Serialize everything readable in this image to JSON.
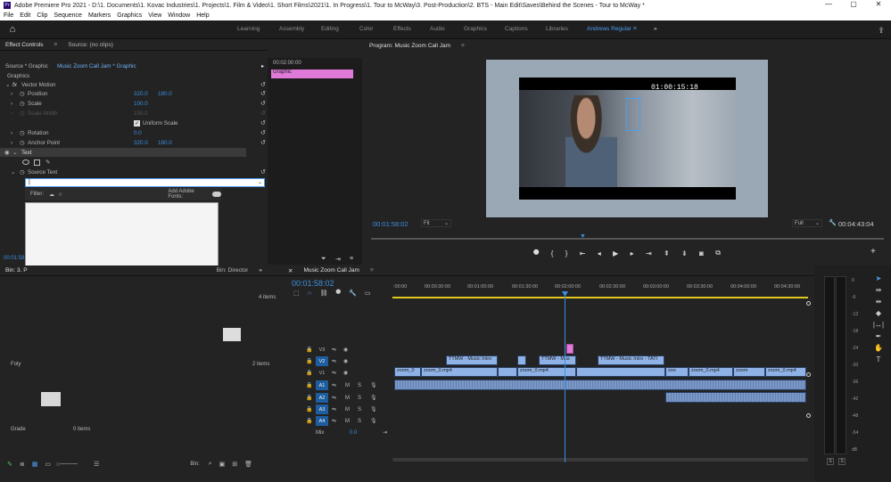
{
  "title_bar": {
    "app_icon": "Pr",
    "title": "Adobe Premiere Pro 2021 - D:\\1. Documents\\1. Kovac Industries\\1. Projects\\1. Film & Video\\1. Short Films\\2021\\1. In Progress\\1. Tour to McWay\\3. Post-Production\\2. BTS - Main Edit\\Saves\\Behind the Scenes - Tour to McWay *",
    "minimize": "—",
    "maximize": "▢",
    "close": "✕"
  },
  "menu": [
    "File",
    "Edit",
    "Clip",
    "Sequence",
    "Markers",
    "Graphics",
    "View",
    "Window",
    "Help"
  ],
  "workspaces": {
    "tabs": [
      "Learning",
      "Assembly",
      "Editing",
      "Color",
      "Effects",
      "Audio",
      "Graphics",
      "Captions",
      "Libraries",
      "Andrews Regular"
    ],
    "more": "»",
    "active": "Andrews Regular"
  },
  "effect_controls": {
    "tabs": [
      "Effect Controls",
      "Source: (no clips)"
    ],
    "active_tab": "Effect Controls",
    "source_label": "Source * Graphic",
    "target_label": "Music Zoom Call Jam * Graphic",
    "section": "Graphics",
    "vector_motion": "Vector Motion",
    "properties": [
      {
        "name": "Position",
        "v1": "320.0",
        "v2": "180.0"
      },
      {
        "name": "Scale",
        "v1": "100.0",
        "v2": ""
      },
      {
        "name": "Scale Width",
        "v1": "100.0",
        "v2": ""
      },
      {
        "name": "Uniform Scale",
        "v1": "",
        "v2": ""
      },
      {
        "name": "Rotation",
        "v1": "0.0",
        "v2": ""
      },
      {
        "name": "Anchor Point",
        "v1": "320.0",
        "v2": "180.0"
      }
    ],
    "text_layer": "Text",
    "source_text": "Source Text",
    "filter_label": "Filter:",
    "add_fonts": "Add Adobe Fonts:",
    "timecode": "00:01:58:"
  },
  "ec_timeline": {
    "timecode": "00:02:00:00",
    "clip_label": "Graphic"
  },
  "program": {
    "title": "Program: Music Zoom Call Jam",
    "overlay_timecode": "01:00:15:18",
    "current_time": "00:01:58:02",
    "fit": "Fit",
    "quality": "Full",
    "duration": "00:04:43:04"
  },
  "project": {
    "bin_tab": "Bin: 3. P",
    "bin_director": "Bin: Director",
    "items_count_1": "4 items",
    "items_count_2": "2 items",
    "folder_1": "Foly",
    "folder_2": "Grade",
    "items_count_3": "0 items",
    "bin_footer": "Bin:"
  },
  "timeline": {
    "tab": "Music Zoom Call Jam",
    "timecode": "00:01:58:02",
    "ruler": [
      ":00:00",
      "00:00:30:00",
      "00:01:00:00",
      "00:01:30:00",
      "00:02:00:00",
      "00:02:30:00",
      "00:03:00:00",
      "00:03:30:00",
      "00:04:00:00",
      "00:04:30:00"
    ],
    "video_tracks": [
      "V3",
      "V2",
      "V1"
    ],
    "audio_tracks": [
      "A1",
      "A2",
      "A3",
      "A4"
    ],
    "mix_label": "Mix",
    "mix_value": "0.0",
    "v2_clips": [
      "TTMW - Music Intro",
      "TTMW - Mus",
      "TTMW - Music Intro - TATI"
    ],
    "v1_clips": [
      "zoom_0",
      "zoom_0.mp4",
      "zoom_0.mp4",
      "zoo",
      "zoom_0.mp4",
      "zoom",
      "zoom_0.mp4"
    ]
  },
  "meters": {
    "scale": [
      "0",
      "-6",
      "-12",
      "-18",
      "-24",
      "-30",
      "-36",
      "-42",
      "-48",
      "-54",
      "dB"
    ],
    "solo": [
      "S",
      "S"
    ]
  },
  "colors": {
    "accent": "#4b9cf0",
    "graphic_clip": "#e07ad9",
    "video_clip": "#8fb2e6",
    "audio_clip": "#7a97c6",
    "playhead": "#3a8fe0"
  }
}
